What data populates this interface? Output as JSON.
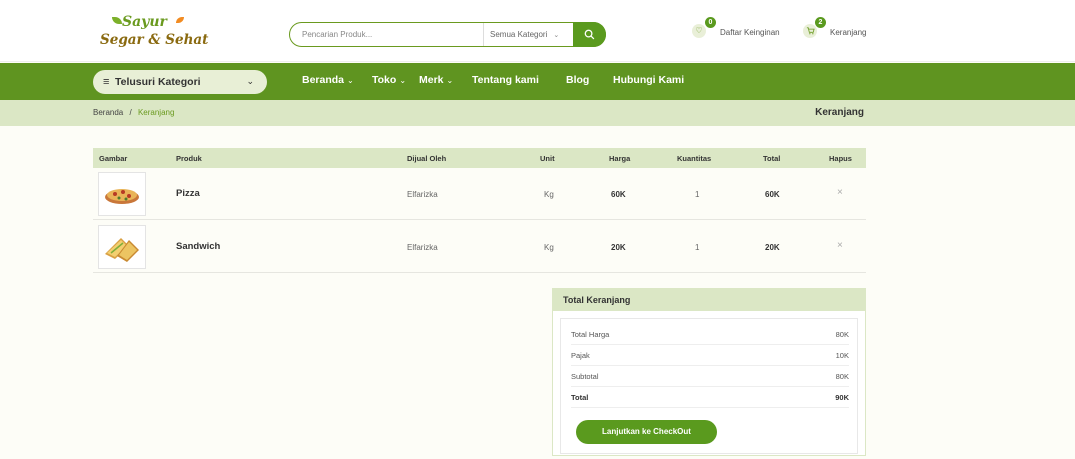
{
  "brand": {
    "line1": "Sayur",
    "line2": "Segar & Sehat"
  },
  "search": {
    "placeholder": "Pencarian Produk...",
    "category": "Semua Kategori"
  },
  "header_actions": {
    "wishlist": {
      "label": "Daftar Keinginan",
      "count": "0"
    },
    "cart": {
      "label": "Keranjang",
      "count": "2"
    }
  },
  "nav": {
    "category_button": "Telusuri Kategori",
    "links": [
      "Beranda",
      "Toko",
      "Merk",
      "Tentang kami",
      "Blog",
      "Hubungi Kami"
    ]
  },
  "breadcrumb": {
    "home": "Beranda",
    "separator": "/",
    "current": "Keranjang",
    "page_title": "Keranjang"
  },
  "cart_table": {
    "headers": [
      "Gambar",
      "Produk",
      "Dijual Oleh",
      "Unit",
      "Harga",
      "Kuantitas",
      "Total",
      "Hapus"
    ],
    "rows": [
      {
        "product": "Pizza",
        "seller": "Elfarizka",
        "unit": "Kg",
        "price": "60K",
        "qty": "1",
        "total": "60K",
        "delete": "×"
      },
      {
        "product": "Sandwich",
        "seller": "Elfarizka",
        "unit": "Kg",
        "price": "20K",
        "qty": "1",
        "total": "20K",
        "delete": "×"
      }
    ]
  },
  "cart_totals": {
    "title": "Total Keranjang",
    "lines": [
      {
        "label": "Total Harga",
        "value": "80K"
      },
      {
        "label": "Pajak",
        "value": "10K"
      },
      {
        "label": "Subtotal",
        "value": "80K"
      },
      {
        "label": "Total",
        "value": "90K"
      }
    ],
    "checkout_label": "Lanjutkan ke CheckOut"
  },
  "icons": {
    "wishlist": "heart-icon",
    "cart": "cart-icon",
    "search": "search-icon",
    "menu": "hamburger-icon",
    "dropdown": "chevron-down-icon",
    "delete": "close-icon"
  },
  "colors": {
    "primary": "#5f9420",
    "light": "#dbe7c5",
    "accent": "#f28b21"
  }
}
